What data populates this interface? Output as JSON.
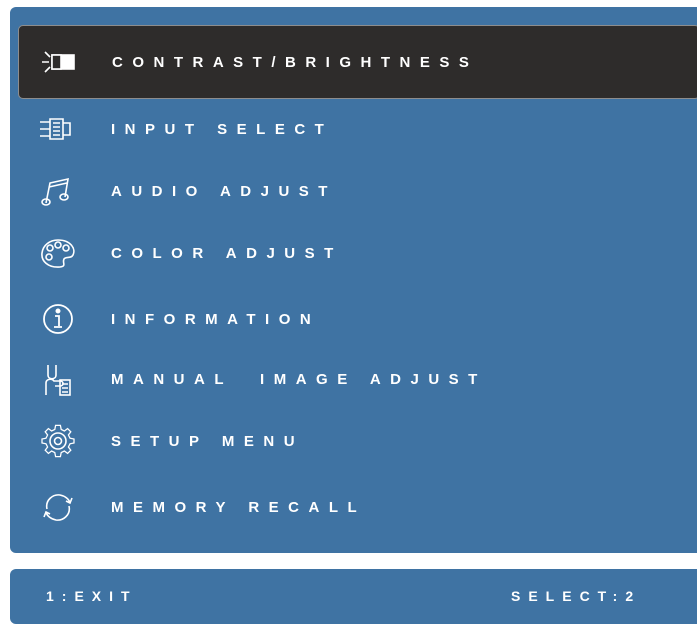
{
  "colors": {
    "panel": "#3f73a3",
    "selected": "#2e2c2b",
    "text": "#ffffff"
  },
  "menu": {
    "items": [
      {
        "label": "CONTRAST/BRIGHTNESS",
        "icon": "contrast-brightness-icon",
        "selected": true
      },
      {
        "label": "INPUT SELECT",
        "icon": "input-select-icon",
        "selected": false
      },
      {
        "label": "AUDIO ADJUST",
        "icon": "audio-icon",
        "selected": false
      },
      {
        "label": "COLOR ADJUST",
        "icon": "color-palette-icon",
        "selected": false
      },
      {
        "label": "INFORMATION",
        "icon": "information-icon",
        "selected": false
      },
      {
        "label": "MANUAL  IMAGE ADJUST",
        "icon": "manual-image-adjust-icon",
        "selected": false
      },
      {
        "label": "SETUP MENU",
        "icon": "gear-icon",
        "selected": false
      },
      {
        "label": "MEMORY RECALL",
        "icon": "memory-recall-icon",
        "selected": false
      }
    ]
  },
  "status": {
    "left": "1:EXIT",
    "right": "SELECT:2"
  }
}
